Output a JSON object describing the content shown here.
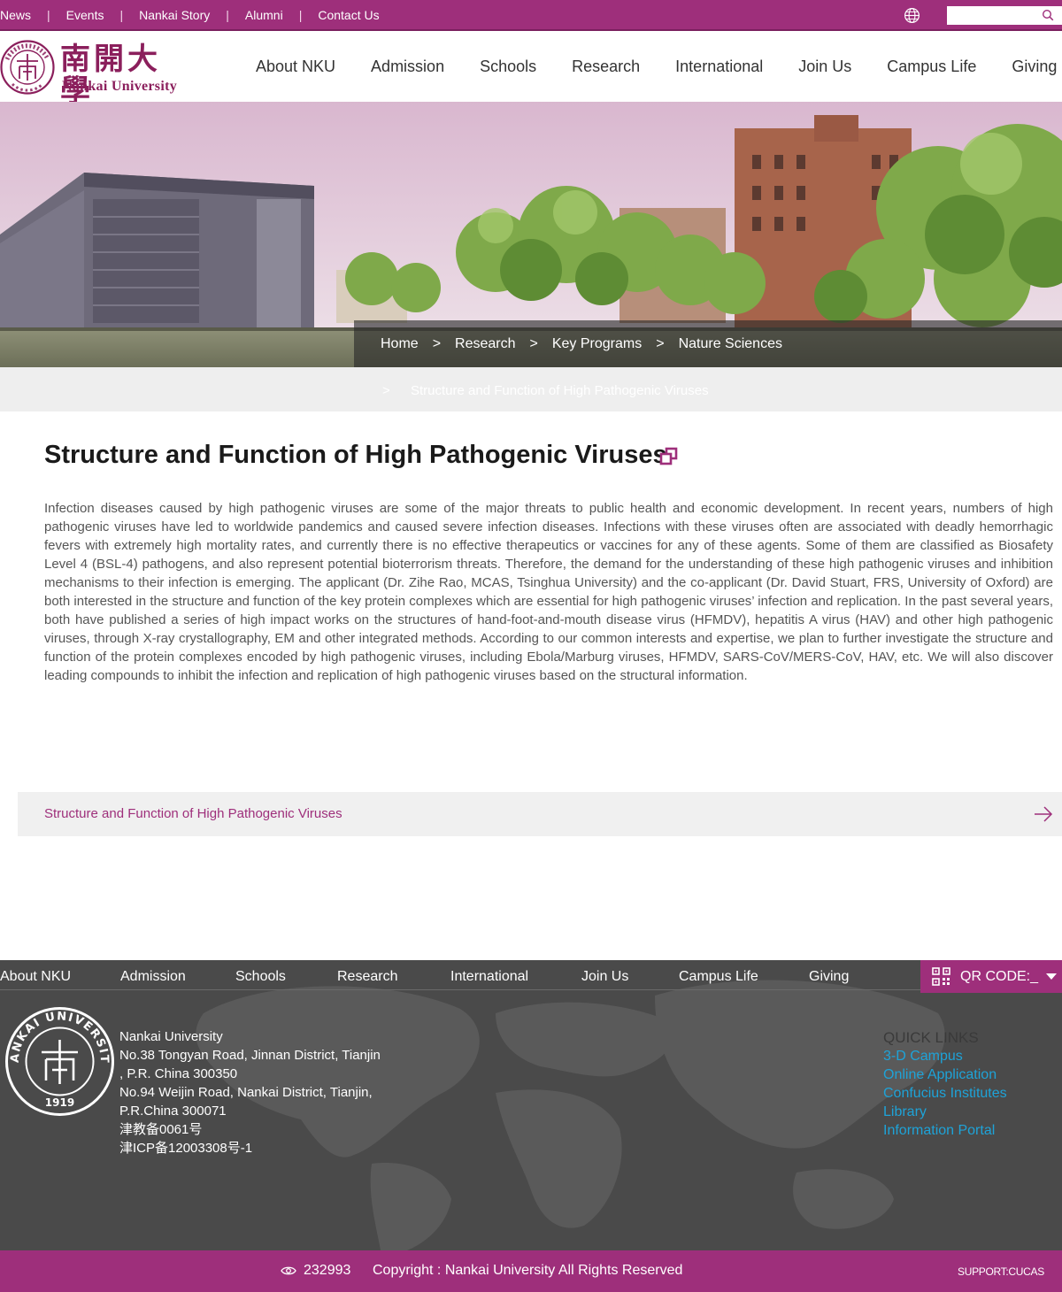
{
  "topbar": {
    "links": [
      "News",
      "Events",
      "Nankai Story",
      "Alumni",
      "Contact Us"
    ],
    "separator": "|",
    "search_placeholder": ""
  },
  "logo": {
    "cn_text": "南開大學",
    "en_text": "Nankai University",
    "seal_year": "1919",
    "seal_ring": "NANKAI UNIVERSITY"
  },
  "mainnav": [
    "About NKU",
    "Admission",
    "Schools",
    "Research",
    "International",
    "Join Us",
    "Campus Life",
    "Giving"
  ],
  "breadcrumb": {
    "items": [
      "Home",
      "Research",
      "Key Programs",
      "Nature Sciences"
    ],
    "separator": ">",
    "current": "Structure and Function of High Pathogenic Viruses"
  },
  "article": {
    "title": "Structure and Function of High Pathogenic Viruses",
    "body": "Infection diseases caused by high pathogenic viruses are some of the major threats to public health and economic development. In recent years, numbers of high pathogenic viruses have led to worldwide pandemics and caused severe infection diseases. Infections with these viruses often are associated with deadly hemorrhagic fevers with extremely high mortality rates, and currently there is no effective therapeutics or vaccines for any of these agents. Some of them are classified as Biosafety Level 4 (BSL-4) pathogens, and also represent potential bioterrorism threats. Therefore, the demand for the understanding of these high pathogenic viruses and inhibition mechanisms to their infection is emerging. The applicant (Dr. Zihe Rao, MCAS, Tsinghua University) and the co-applicant (Dr. David Stuart, FRS, University of Oxford) are both interested in the structure and function of the key protein complexes which are essential for high pathogenic viruses’ infection and replication. In the past several years, both have published a series of high impact works on the structures of hand-foot-and-mouth disease virus (HFMDV), hepatitis A virus (HAV) and other high pathogenic viruses, through X-ray crystallography, EM and other integrated methods. According to our common interests and expertise, we plan to further investigate the structure and function of the protein complexes encoded by high pathogenic viruses, including Ebola/Marburg viruses, HFMDV, SARS-CoV/MERS-CoV, HAV, etc. We will also discover leading compounds to inhibit the infection and replication of high pathogenic viruses based on the structural information."
  },
  "related": {
    "link": "Structure and Function of High Pathogenic Viruses"
  },
  "footer": {
    "nav": [
      "About NKU",
      "Admission",
      "Schools",
      "Research",
      "International",
      "Join Us",
      "Campus Life",
      "Giving"
    ],
    "qr_label": "QR CODE:_",
    "address": [
      "Nankai University",
      "No.38 Tongyan Road, Jinnan District, Tianjin",
      ", P.R. China 300350",
      "No.94 Weijin Road,  Nankai District, Tianjin,",
      "P.R.China  300071",
      "津教备0061号",
      "津ICP备12003308号-1"
    ],
    "quick_links_heading": "QUICK LINKS",
    "quick_links": [
      "3-D Campus",
      "Online Application",
      "Confucius Institutes",
      "Library",
      "Information Portal"
    ],
    "visit_count": "232993",
    "copyright": "Copyright : Nankai University All Rights Reserved",
    "support": "SUPPORT:CUCAS"
  },
  "colors": {
    "brand": "#9e2f7b",
    "footer_bg": "#4a4a4a",
    "quick_link": "#1ea3d8"
  }
}
